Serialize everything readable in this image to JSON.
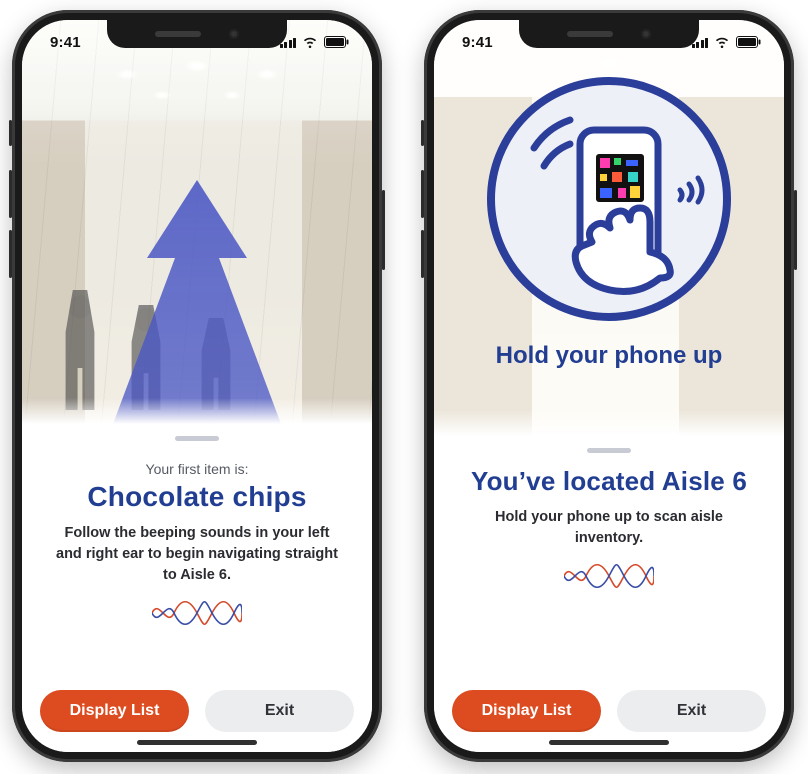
{
  "status": {
    "time": "9:41"
  },
  "screen_left": {
    "eyebrow": "Your first item is:",
    "title": "Chocolate chips",
    "body": "Follow the beeping sounds in your left and right ear to begin navigating straight to Aisle 6.",
    "primary_button": "Display List",
    "secondary_button": "Exit"
  },
  "screen_right": {
    "overlay_caption": "Hold your phone up",
    "title": "You’ve located Aisle 6",
    "body": "Hold your phone up to scan aisle inventory.",
    "primary_button": "Display List",
    "secondary_button": "Exit"
  },
  "colors": {
    "brand_blue": "#223e93",
    "accent_orange": "#dd4b20"
  }
}
